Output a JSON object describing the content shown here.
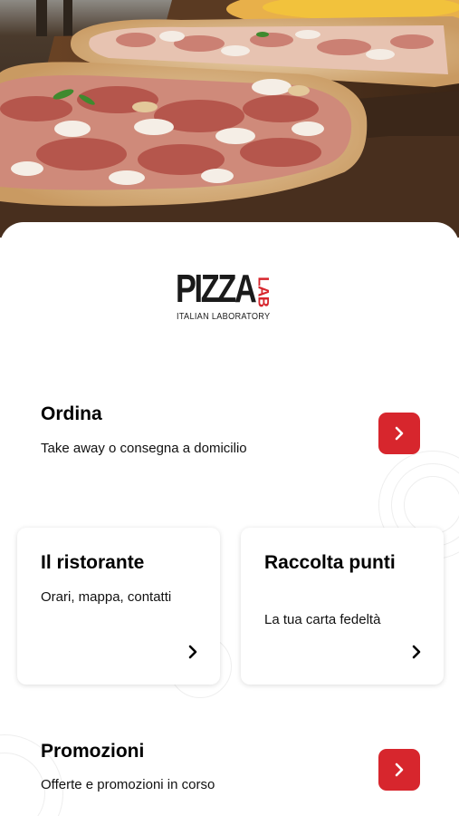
{
  "brand": {
    "logo_main": "PIZZA",
    "logo_accent": "LAB",
    "logo_tagline": "ITALIAN LABORATORY",
    "accent_color": "#d7262d"
  },
  "hero": {
    "image": "pizza-al-taglio-photo"
  },
  "order": {
    "title": "Ordina",
    "subtitle": "Take away o consegna a domicilio",
    "icon": "chevron-right-icon"
  },
  "cards": [
    {
      "title": "Il ristorante",
      "subtitle": "Orari, mappa, contatti",
      "icon": "chevron-right-icon"
    },
    {
      "title": "Raccolta punti",
      "subtitle": "La tua carta fedeltà",
      "icon": "chevron-right-icon"
    }
  ],
  "promotions": {
    "title": "Promozioni",
    "subtitle": "Offerte e promozioni in corso",
    "icon": "chevron-right-icon"
  }
}
